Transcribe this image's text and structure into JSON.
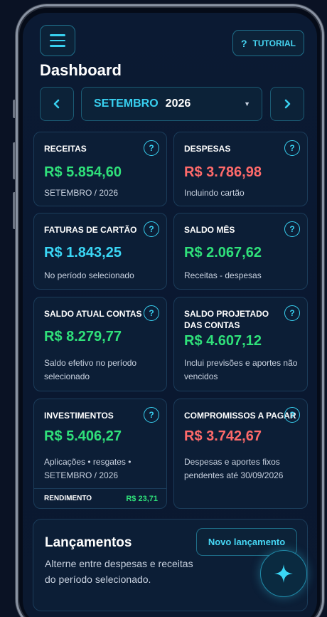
{
  "header": {
    "tutorial_icon": "?",
    "tutorial_label": "TUTORIAL",
    "title": "Dashboard"
  },
  "period": {
    "prev": "‹",
    "month": "SETEMBRO",
    "year": "2026",
    "caret": "▼",
    "next": "›"
  },
  "cards": {
    "receitas": {
      "label": "RECEITAS",
      "value": "R$ 5.854,60",
      "sub": "SETEMBRO / 2026"
    },
    "despesas": {
      "label": "DESPESAS",
      "value": "R$ 3.786,98",
      "sub": "Incluindo cartão"
    },
    "faturas": {
      "label": "FATURAS DE CARTÃO",
      "value": "R$ 1.843,25",
      "sub": "No período selecionado"
    },
    "saldo_mes": {
      "label": "SALDO MÊS",
      "value": "R$ 2.067,62",
      "sub": "Receitas - despesas"
    },
    "saldo_atual": {
      "label": "SALDO ATUAL CONTAS",
      "value": "R$ 8.279,77",
      "sub": "Saldo efetivo no período selecionado"
    },
    "saldo_projetado": {
      "label": "SALDO PROJETADO DAS CONTAS",
      "value": "R$ 4.607,12",
      "sub": "Inclui previsões e aportes não vencidos"
    },
    "investimentos": {
      "label": "INVESTIMENTOS",
      "value": "R$ 5.406,27",
      "sub": "Aplicações • resgates • SETEMBRO / 2026",
      "rend_label": "RENDIMENTO",
      "rend_value": "R$ 23,71"
    },
    "compromissos": {
      "label": "COMPROMISSOS A PAGAR",
      "value": "R$ 3.742,67",
      "sub": "Despesas e aportes fixos pendentes até 30/09/2026"
    },
    "help_icon": "?"
  },
  "lancamentos": {
    "title": "Lançamentos",
    "description": "Alterne entre despesas e receitas do período selecionado.",
    "button": "Novo lançamento"
  },
  "colors": {
    "accent": "#38d0f0",
    "positive": "#2fe07a",
    "negative": "#ff6a6a",
    "background": "#0b1a33"
  },
  "icons": {
    "menu": "hamburger-menu-icon",
    "fab": "sparkle-icon"
  }
}
